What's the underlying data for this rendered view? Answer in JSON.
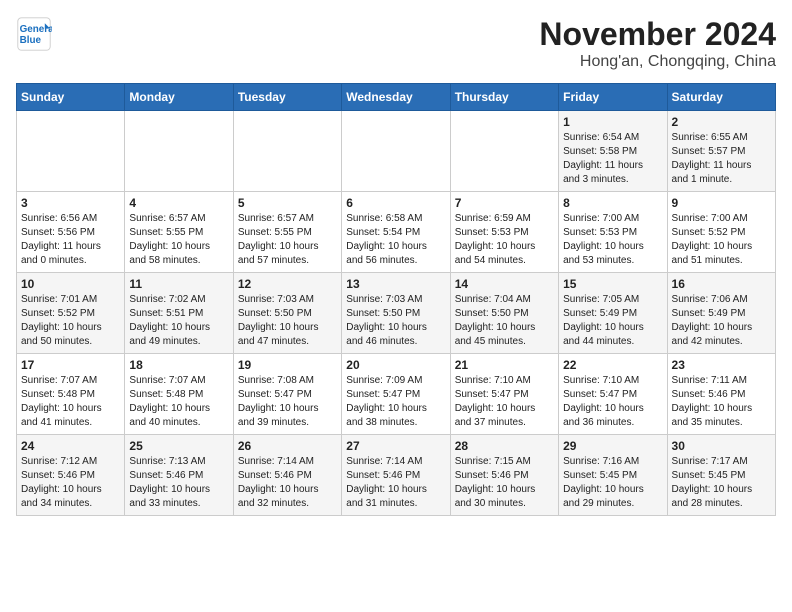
{
  "header": {
    "title": "November 2024",
    "subtitle": "Hong'an, Chongqing, China",
    "logo_line1": "General",
    "logo_line2": "Blue"
  },
  "weekdays": [
    "Sunday",
    "Monday",
    "Tuesday",
    "Wednesday",
    "Thursday",
    "Friday",
    "Saturday"
  ],
  "weeks": [
    [
      {
        "day": "",
        "info": ""
      },
      {
        "day": "",
        "info": ""
      },
      {
        "day": "",
        "info": ""
      },
      {
        "day": "",
        "info": ""
      },
      {
        "day": "",
        "info": ""
      },
      {
        "day": "1",
        "info": "Sunrise: 6:54 AM\nSunset: 5:58 PM\nDaylight: 11 hours\nand 3 minutes."
      },
      {
        "day": "2",
        "info": "Sunrise: 6:55 AM\nSunset: 5:57 PM\nDaylight: 11 hours\nand 1 minute."
      }
    ],
    [
      {
        "day": "3",
        "info": "Sunrise: 6:56 AM\nSunset: 5:56 PM\nDaylight: 11 hours\nand 0 minutes."
      },
      {
        "day": "4",
        "info": "Sunrise: 6:57 AM\nSunset: 5:55 PM\nDaylight: 10 hours\nand 58 minutes."
      },
      {
        "day": "5",
        "info": "Sunrise: 6:57 AM\nSunset: 5:55 PM\nDaylight: 10 hours\nand 57 minutes."
      },
      {
        "day": "6",
        "info": "Sunrise: 6:58 AM\nSunset: 5:54 PM\nDaylight: 10 hours\nand 56 minutes."
      },
      {
        "day": "7",
        "info": "Sunrise: 6:59 AM\nSunset: 5:53 PM\nDaylight: 10 hours\nand 54 minutes."
      },
      {
        "day": "8",
        "info": "Sunrise: 7:00 AM\nSunset: 5:53 PM\nDaylight: 10 hours\nand 53 minutes."
      },
      {
        "day": "9",
        "info": "Sunrise: 7:00 AM\nSunset: 5:52 PM\nDaylight: 10 hours\nand 51 minutes."
      }
    ],
    [
      {
        "day": "10",
        "info": "Sunrise: 7:01 AM\nSunset: 5:52 PM\nDaylight: 10 hours\nand 50 minutes."
      },
      {
        "day": "11",
        "info": "Sunrise: 7:02 AM\nSunset: 5:51 PM\nDaylight: 10 hours\nand 49 minutes."
      },
      {
        "day": "12",
        "info": "Sunrise: 7:03 AM\nSunset: 5:50 PM\nDaylight: 10 hours\nand 47 minutes."
      },
      {
        "day": "13",
        "info": "Sunrise: 7:03 AM\nSunset: 5:50 PM\nDaylight: 10 hours\nand 46 minutes."
      },
      {
        "day": "14",
        "info": "Sunrise: 7:04 AM\nSunset: 5:50 PM\nDaylight: 10 hours\nand 45 minutes."
      },
      {
        "day": "15",
        "info": "Sunrise: 7:05 AM\nSunset: 5:49 PM\nDaylight: 10 hours\nand 44 minutes."
      },
      {
        "day": "16",
        "info": "Sunrise: 7:06 AM\nSunset: 5:49 PM\nDaylight: 10 hours\nand 42 minutes."
      }
    ],
    [
      {
        "day": "17",
        "info": "Sunrise: 7:07 AM\nSunset: 5:48 PM\nDaylight: 10 hours\nand 41 minutes."
      },
      {
        "day": "18",
        "info": "Sunrise: 7:07 AM\nSunset: 5:48 PM\nDaylight: 10 hours\nand 40 minutes."
      },
      {
        "day": "19",
        "info": "Sunrise: 7:08 AM\nSunset: 5:47 PM\nDaylight: 10 hours\nand 39 minutes."
      },
      {
        "day": "20",
        "info": "Sunrise: 7:09 AM\nSunset: 5:47 PM\nDaylight: 10 hours\nand 38 minutes."
      },
      {
        "day": "21",
        "info": "Sunrise: 7:10 AM\nSunset: 5:47 PM\nDaylight: 10 hours\nand 37 minutes."
      },
      {
        "day": "22",
        "info": "Sunrise: 7:10 AM\nSunset: 5:47 PM\nDaylight: 10 hours\nand 36 minutes."
      },
      {
        "day": "23",
        "info": "Sunrise: 7:11 AM\nSunset: 5:46 PM\nDaylight: 10 hours\nand 35 minutes."
      }
    ],
    [
      {
        "day": "24",
        "info": "Sunrise: 7:12 AM\nSunset: 5:46 PM\nDaylight: 10 hours\nand 34 minutes."
      },
      {
        "day": "25",
        "info": "Sunrise: 7:13 AM\nSunset: 5:46 PM\nDaylight: 10 hours\nand 33 minutes."
      },
      {
        "day": "26",
        "info": "Sunrise: 7:14 AM\nSunset: 5:46 PM\nDaylight: 10 hours\nand 32 minutes."
      },
      {
        "day": "27",
        "info": "Sunrise: 7:14 AM\nSunset: 5:46 PM\nDaylight: 10 hours\nand 31 minutes."
      },
      {
        "day": "28",
        "info": "Sunrise: 7:15 AM\nSunset: 5:46 PM\nDaylight: 10 hours\nand 30 minutes."
      },
      {
        "day": "29",
        "info": "Sunrise: 7:16 AM\nSunset: 5:45 PM\nDaylight: 10 hours\nand 29 minutes."
      },
      {
        "day": "30",
        "info": "Sunrise: 7:17 AM\nSunset: 5:45 PM\nDaylight: 10 hours\nand 28 minutes."
      }
    ]
  ]
}
